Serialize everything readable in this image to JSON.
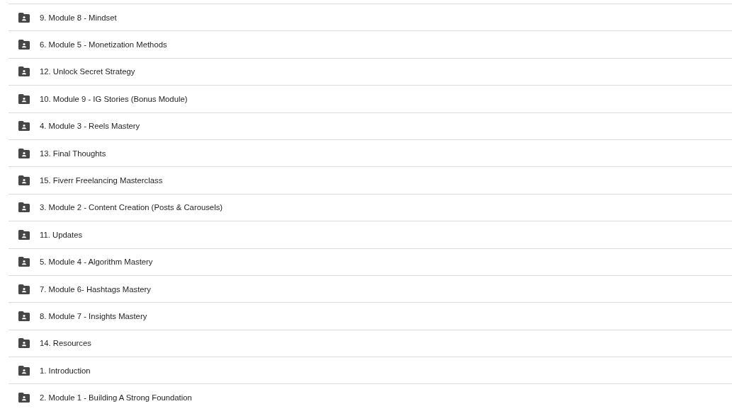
{
  "folders": [
    {
      "name": "9. Module 8 - Mindset",
      "kind": "shared"
    },
    {
      "name": "6. Module 5 - Monetization Methods",
      "kind": "shared"
    },
    {
      "name": "12. Unlock Secret Strategy",
      "kind": "shared"
    },
    {
      "name": "10. Module 9 - IG Stories (Bonus Module)",
      "kind": "shared"
    },
    {
      "name": "4. Module 3 - Reels Mastery",
      "kind": "shared"
    },
    {
      "name": "13. Final Thoughts",
      "kind": "shared"
    },
    {
      "name": "15. Fiverr Freelancing Masterclass",
      "kind": "shared"
    },
    {
      "name": "3. Module 2 - Content Creation (Posts & Carousels)",
      "kind": "shared"
    },
    {
      "name": "11. Updates",
      "kind": "shared"
    },
    {
      "name": "5. Module 4 - Algorithm Mastery",
      "kind": "shared"
    },
    {
      "name": "7. Module 6- Hashtags Mastery",
      "kind": "shared"
    },
    {
      "name": "8. Module 7 - Insights Mastery",
      "kind": "shared"
    },
    {
      "name": "14. Resources",
      "kind": "shared"
    },
    {
      "name": "1. Introduction",
      "kind": "shared"
    },
    {
      "name": "2. Module 1 - Building A Strong Foundation",
      "kind": "shared"
    }
  ]
}
